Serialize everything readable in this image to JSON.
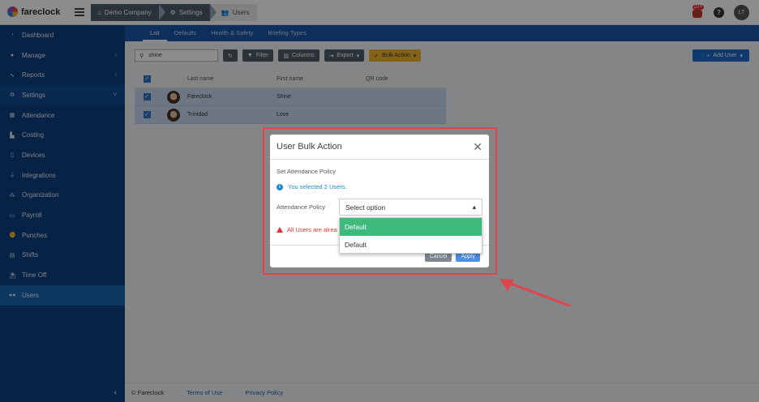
{
  "app": {
    "name": "fareclock"
  },
  "breadcrumbs": [
    "Demo Company",
    "Settings",
    "Users"
  ],
  "header": {
    "notifications": "27+",
    "help": "?",
    "avatar": "LT"
  },
  "sidebar": {
    "items": [
      {
        "label": "Dashboard",
        "icon": "dashboard-icon"
      },
      {
        "label": "Manage",
        "icon": "user-icon"
      },
      {
        "label": "Reports",
        "icon": "chart-icon"
      },
      {
        "label": "Settings",
        "icon": "gear-icon"
      },
      {
        "label": "Attendance",
        "icon": "attendance-icon"
      },
      {
        "label": "Costing",
        "icon": "costing-icon"
      },
      {
        "label": "Devices",
        "icon": "device-icon"
      },
      {
        "label": "Integrations",
        "icon": "plug-icon"
      },
      {
        "label": "Organization",
        "icon": "org-icon"
      },
      {
        "label": "Payroll",
        "icon": "payroll-icon"
      },
      {
        "label": "Punches",
        "icon": "punch-icon"
      },
      {
        "label": "Shifts",
        "icon": "shift-icon"
      },
      {
        "label": "Time Off",
        "icon": "beach-icon"
      },
      {
        "label": "Users",
        "icon": "users-icon"
      }
    ]
  },
  "tabs": [
    "List",
    "Defaults",
    "Health & Safety",
    "Briefing Types"
  ],
  "toolbar": {
    "search_value": "shine",
    "filter": "Filter",
    "columns": "Columns",
    "export": "Export",
    "bulk_action": "Bulk Action",
    "add_user": "Add User"
  },
  "table": {
    "columns": [
      "Last name",
      "First name",
      "QR code"
    ],
    "rows": [
      {
        "last": "Fareclock",
        "first": "Shine"
      },
      {
        "last": "Trinidad",
        "first": "Love"
      }
    ]
  },
  "modal": {
    "title": "User Bulk Action",
    "section": "Set Attendance Policy",
    "info": "You selected 2 Users.",
    "field_label": "Attendance Policy",
    "select_placeholder": "Select option",
    "warning": "All Users are alrea",
    "cancel": "Cancel",
    "apply": "Apply"
  },
  "dropdown": {
    "options": [
      "Default",
      "Default"
    ]
  },
  "footer": {
    "copyright": "© Fareclock",
    "terms": "Terms of Use",
    "privacy": "Privacy Policy"
  },
  "colors": {
    "sidebar": "#0c3f7e",
    "active": "#1b66b3",
    "highlight": "#e0454c",
    "option_highlight": "#3fba7d"
  }
}
